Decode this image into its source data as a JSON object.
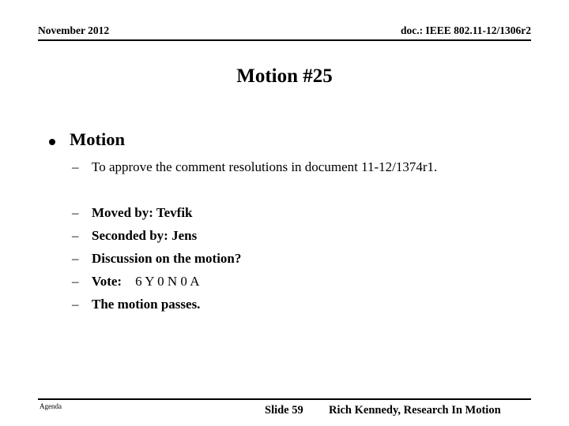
{
  "header": {
    "date": "November 2012",
    "doc": "doc.: IEEE 802.11-12/1306r2"
  },
  "title": "Motion #25",
  "content": {
    "bullet": "Motion",
    "sub_items": [
      {
        "dash": "–",
        "text": "To approve the comment resolutions in document 11-12/1374r1."
      },
      {
        "dash": "–",
        "text": "Moved by: Tevfik"
      },
      {
        "dash": "–",
        "text": "Seconded by: Jens"
      },
      {
        "dash": "–",
        "text": "Discussion on the motion?"
      },
      {
        "dash": "–",
        "label": "Vote:",
        "value": "6 Y   0 N  0 A"
      },
      {
        "dash": "–",
        "text": "The motion passes."
      }
    ]
  },
  "footer": {
    "agenda": "Agenda",
    "slide_number": "Slide 59",
    "presenter": "Rich Kennedy, Research In Motion"
  },
  "colors": {
    "text": "#000000",
    "background": "#ffffff",
    "rule": "#000000"
  }
}
